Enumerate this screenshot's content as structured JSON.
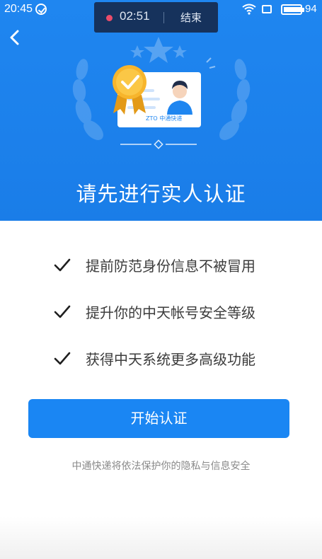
{
  "status_bar": {
    "time": "20:45",
    "battery_level": "94",
    "icons": [
      "check-circle-icon",
      "wifi-icon",
      "window-icon",
      "battery-icon"
    ]
  },
  "call_banner": {
    "timer": "02:51",
    "end_label": "结束"
  },
  "header": {
    "back_icon": "chevron-left-icon",
    "title": "请先进行实人认证",
    "card_logo_text": "ZTO 中通快递"
  },
  "benefits": [
    {
      "icon": "check-icon",
      "text": "提前防范身份信息不被冒用"
    },
    {
      "icon": "check-icon",
      "text": "提升你的中天帐号安全等级"
    },
    {
      "icon": "check-icon",
      "text": "获得中天系统更多高级功能"
    }
  ],
  "actions": {
    "start_label": "开始认证"
  },
  "footer": {
    "privacy_text": "中通快递将依法保护你的隐私与信息安全"
  },
  "colors": {
    "hero_blue": "#1f86f0",
    "button_blue": "#1a86f3",
    "call_banner": "#16325c",
    "gold_badge": "#f7b52c"
  }
}
